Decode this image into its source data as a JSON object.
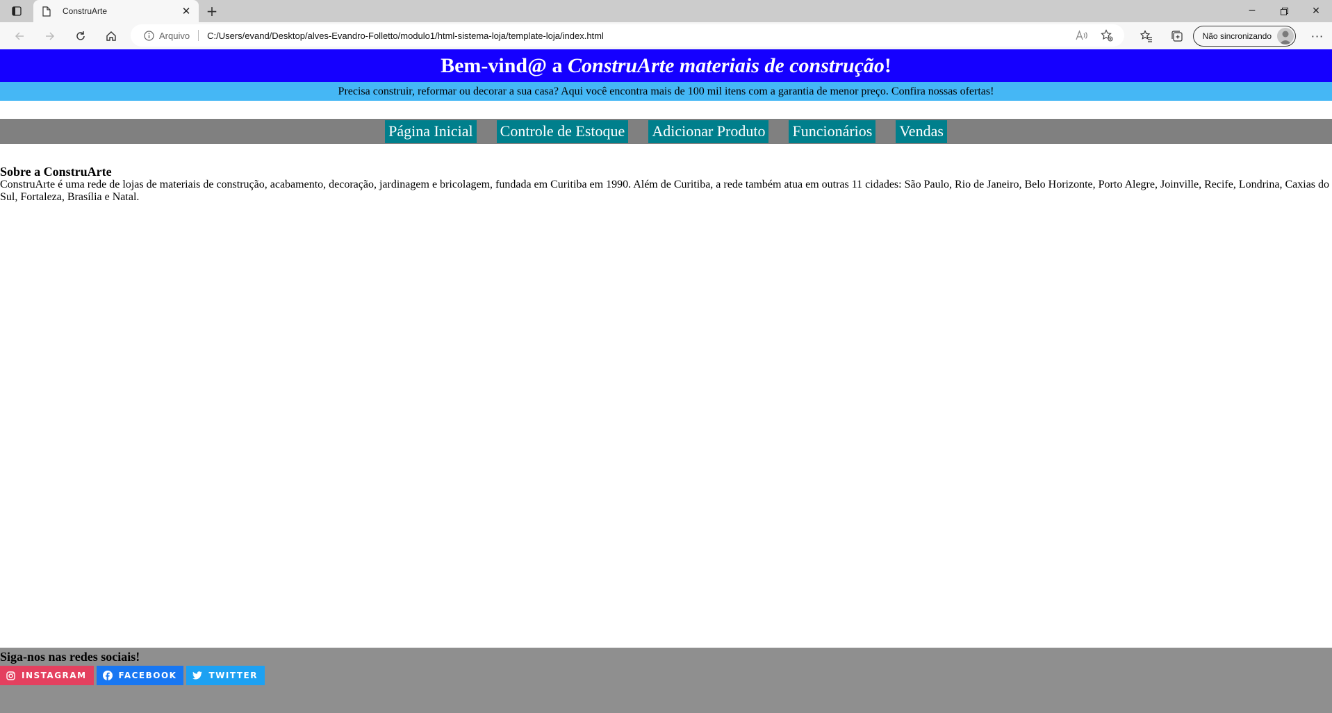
{
  "browser": {
    "tab_title": "ConstruArte",
    "address_label": "Arquivo",
    "url": "C:/Users/evand/Desktop/alves-Evandro-Folletto/modulo1/html-sistema-loja/template-loja/index.html",
    "profile_label": "Não sincronizando",
    "more_label": "···"
  },
  "header": {
    "title_prefix": "Bem-vind@ a ",
    "title_brand": "ConstruArte materiais de construção",
    "title_suffix": "!",
    "tagline": "Precisa construir, reformar ou decorar a sua casa? Aqui você encontra mais de 100 mil itens com a garantia de menor preço. Confira nossas ofertas!"
  },
  "nav": {
    "items": [
      {
        "label": "Página Inicial"
      },
      {
        "label": "Controle de Estoque"
      },
      {
        "label": "Adicionar Produto"
      },
      {
        "label": "Funcionários"
      },
      {
        "label": "Vendas"
      }
    ]
  },
  "about": {
    "heading": "Sobre a ConstruArte",
    "text": "ConstruArte é uma rede de lojas de materiais de construção, acabamento, decoração, jardinagem e bricolagem, fundada em Curitiba em 1990. Além de Curitiba, a rede também atua em outras 11 cidades: São Paulo, Rio de Janeiro, Belo Horizonte, Porto Alegre, Joinville, Recife, Londrina, Caxias do Sul, Fortaleza, Brasília e Natal."
  },
  "footer": {
    "title": "Siga-nos nas redes sociais!",
    "socials": [
      {
        "label": "INSTAGRAM",
        "icon": "instagram-icon",
        "color": "#e4405f"
      },
      {
        "label": "FACEBOOK",
        "icon": "facebook-icon",
        "color": "#1877f2"
      },
      {
        "label": "TWITTER",
        "icon": "twitter-icon",
        "color": "#1da1f2"
      }
    ]
  },
  "colors": {
    "hero_bg": "#1500ff",
    "tagline_bg": "#45b7f5",
    "menu_bg": "#808080",
    "menu_item_bg": "#007f8c",
    "footer_bg": "#8f8f8f"
  }
}
